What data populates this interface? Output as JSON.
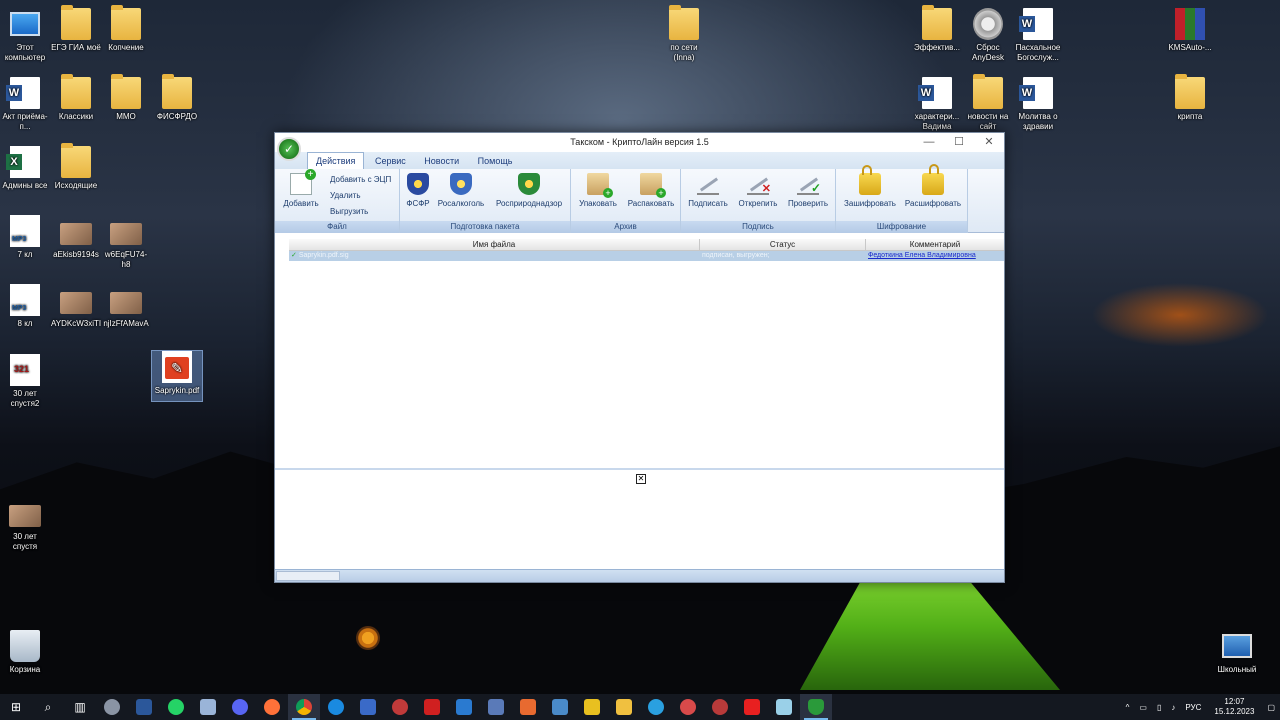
{
  "desktop": {
    "icons_left": [
      {
        "label": "Этот компьютер",
        "type": "pc"
      },
      {
        "label": "ЕГЭ ГИА моё",
        "type": "folder"
      },
      {
        "label": "Копчение",
        "type": "folder"
      },
      {
        "label": "Акт приёма-п...",
        "type": "word"
      },
      {
        "label": "Классики",
        "type": "folder"
      },
      {
        "label": "ММО",
        "type": "folder"
      },
      {
        "label": "ФИСФРДО",
        "type": "folder"
      },
      {
        "label": "Админы все",
        "type": "excel"
      },
      {
        "label": "Исходящие",
        "type": "folder"
      },
      {
        "label": "7 кл",
        "type": "mp3"
      },
      {
        "label": "aEkisb9194s",
        "type": "img"
      },
      {
        "label": "w6EqFU74-h8",
        "type": "img"
      },
      {
        "label": "8 кл",
        "type": "mp3"
      },
      {
        "label": "AYDKcW3xiTI",
        "type": "img"
      },
      {
        "label": "njIzFfAMavA",
        "type": "img"
      },
      {
        "label": "30 лет спустя2",
        "type": "video"
      },
      {
        "label": "Saprykin.pdf",
        "type": "sig"
      },
      {
        "label": "30 лет спустя",
        "type": "img"
      },
      {
        "label": "Корзина",
        "type": "recycle"
      }
    ],
    "icons_top": [
      {
        "label": "по сети (Inna)",
        "type": "folder"
      }
    ],
    "icons_right": [
      {
        "label": "Эффектив...",
        "type": "folder"
      },
      {
        "label": "Сброс AnyDesk",
        "type": "gear"
      },
      {
        "label": "Пасхальное Богослуж...",
        "type": "word"
      },
      {
        "label": "KMSAuto-...",
        "type": "winrar"
      },
      {
        "label": "характери... Вадима",
        "type": "word"
      },
      {
        "label": "новости на сайт",
        "type": "folder"
      },
      {
        "label": "Молитва о здравии",
        "type": "word"
      },
      {
        "label": "крипта",
        "type": "folder"
      },
      {
        "label": "Школьный",
        "type": "school"
      }
    ]
  },
  "window": {
    "title": "Такском - КриптоЛайн версия 1.5",
    "controls": {
      "minimize": "—",
      "maximize": "☐",
      "close": "✕"
    },
    "tabs": [
      "Действия",
      "Сервис",
      "Новости",
      "Помощь"
    ],
    "ribbon": {
      "file": {
        "label": "Файл",
        "add": "Добавить",
        "add_ecp": "Добавить с ЭЦП",
        "delete": "Удалить",
        "unload": "Выгрузить"
      },
      "package": {
        "label": "Подготовка пакета",
        "fsfr": "ФСФР",
        "rosalkogol": "Росалкоголь",
        "rosprirodnadzor": "Росприроднадзор"
      },
      "archive": {
        "label": "Архив",
        "pack": "Упаковать",
        "unpack": "Распаковать"
      },
      "signature": {
        "label": "Подпись",
        "sign": "Подписать",
        "unsign": "Открепить",
        "verify": "Проверить"
      },
      "encryption": {
        "label": "Шифрование",
        "encrypt": "Зашифровать",
        "decrypt": "Расшифровать"
      }
    },
    "grid": {
      "columns": {
        "filename": "Имя файла",
        "status": "Статус",
        "comment": "Комментарий"
      },
      "rows": [
        {
          "filename": "Saprykin.pdf.sig",
          "status": "подписан, выгружен;",
          "comment": "Федоткина Елена Владимировна"
        }
      ]
    },
    "bottom_pane_icon": "broken-image-icon"
  },
  "taskbar": {
    "apps": [
      "start",
      "search",
      "task-view",
      "app",
      "word",
      "whatsapp",
      "app",
      "discord",
      "firefox",
      "chrome",
      "app",
      "save",
      "app",
      "rs",
      "app",
      "app",
      "app",
      "app",
      "explorer",
      "telegram",
      "app",
      "app",
      "app",
      "app",
      "kriptoline"
    ],
    "tray": {
      "chevron": "^",
      "lang": "РУС",
      "time": "12:07",
      "date": "15.12.2023"
    }
  }
}
